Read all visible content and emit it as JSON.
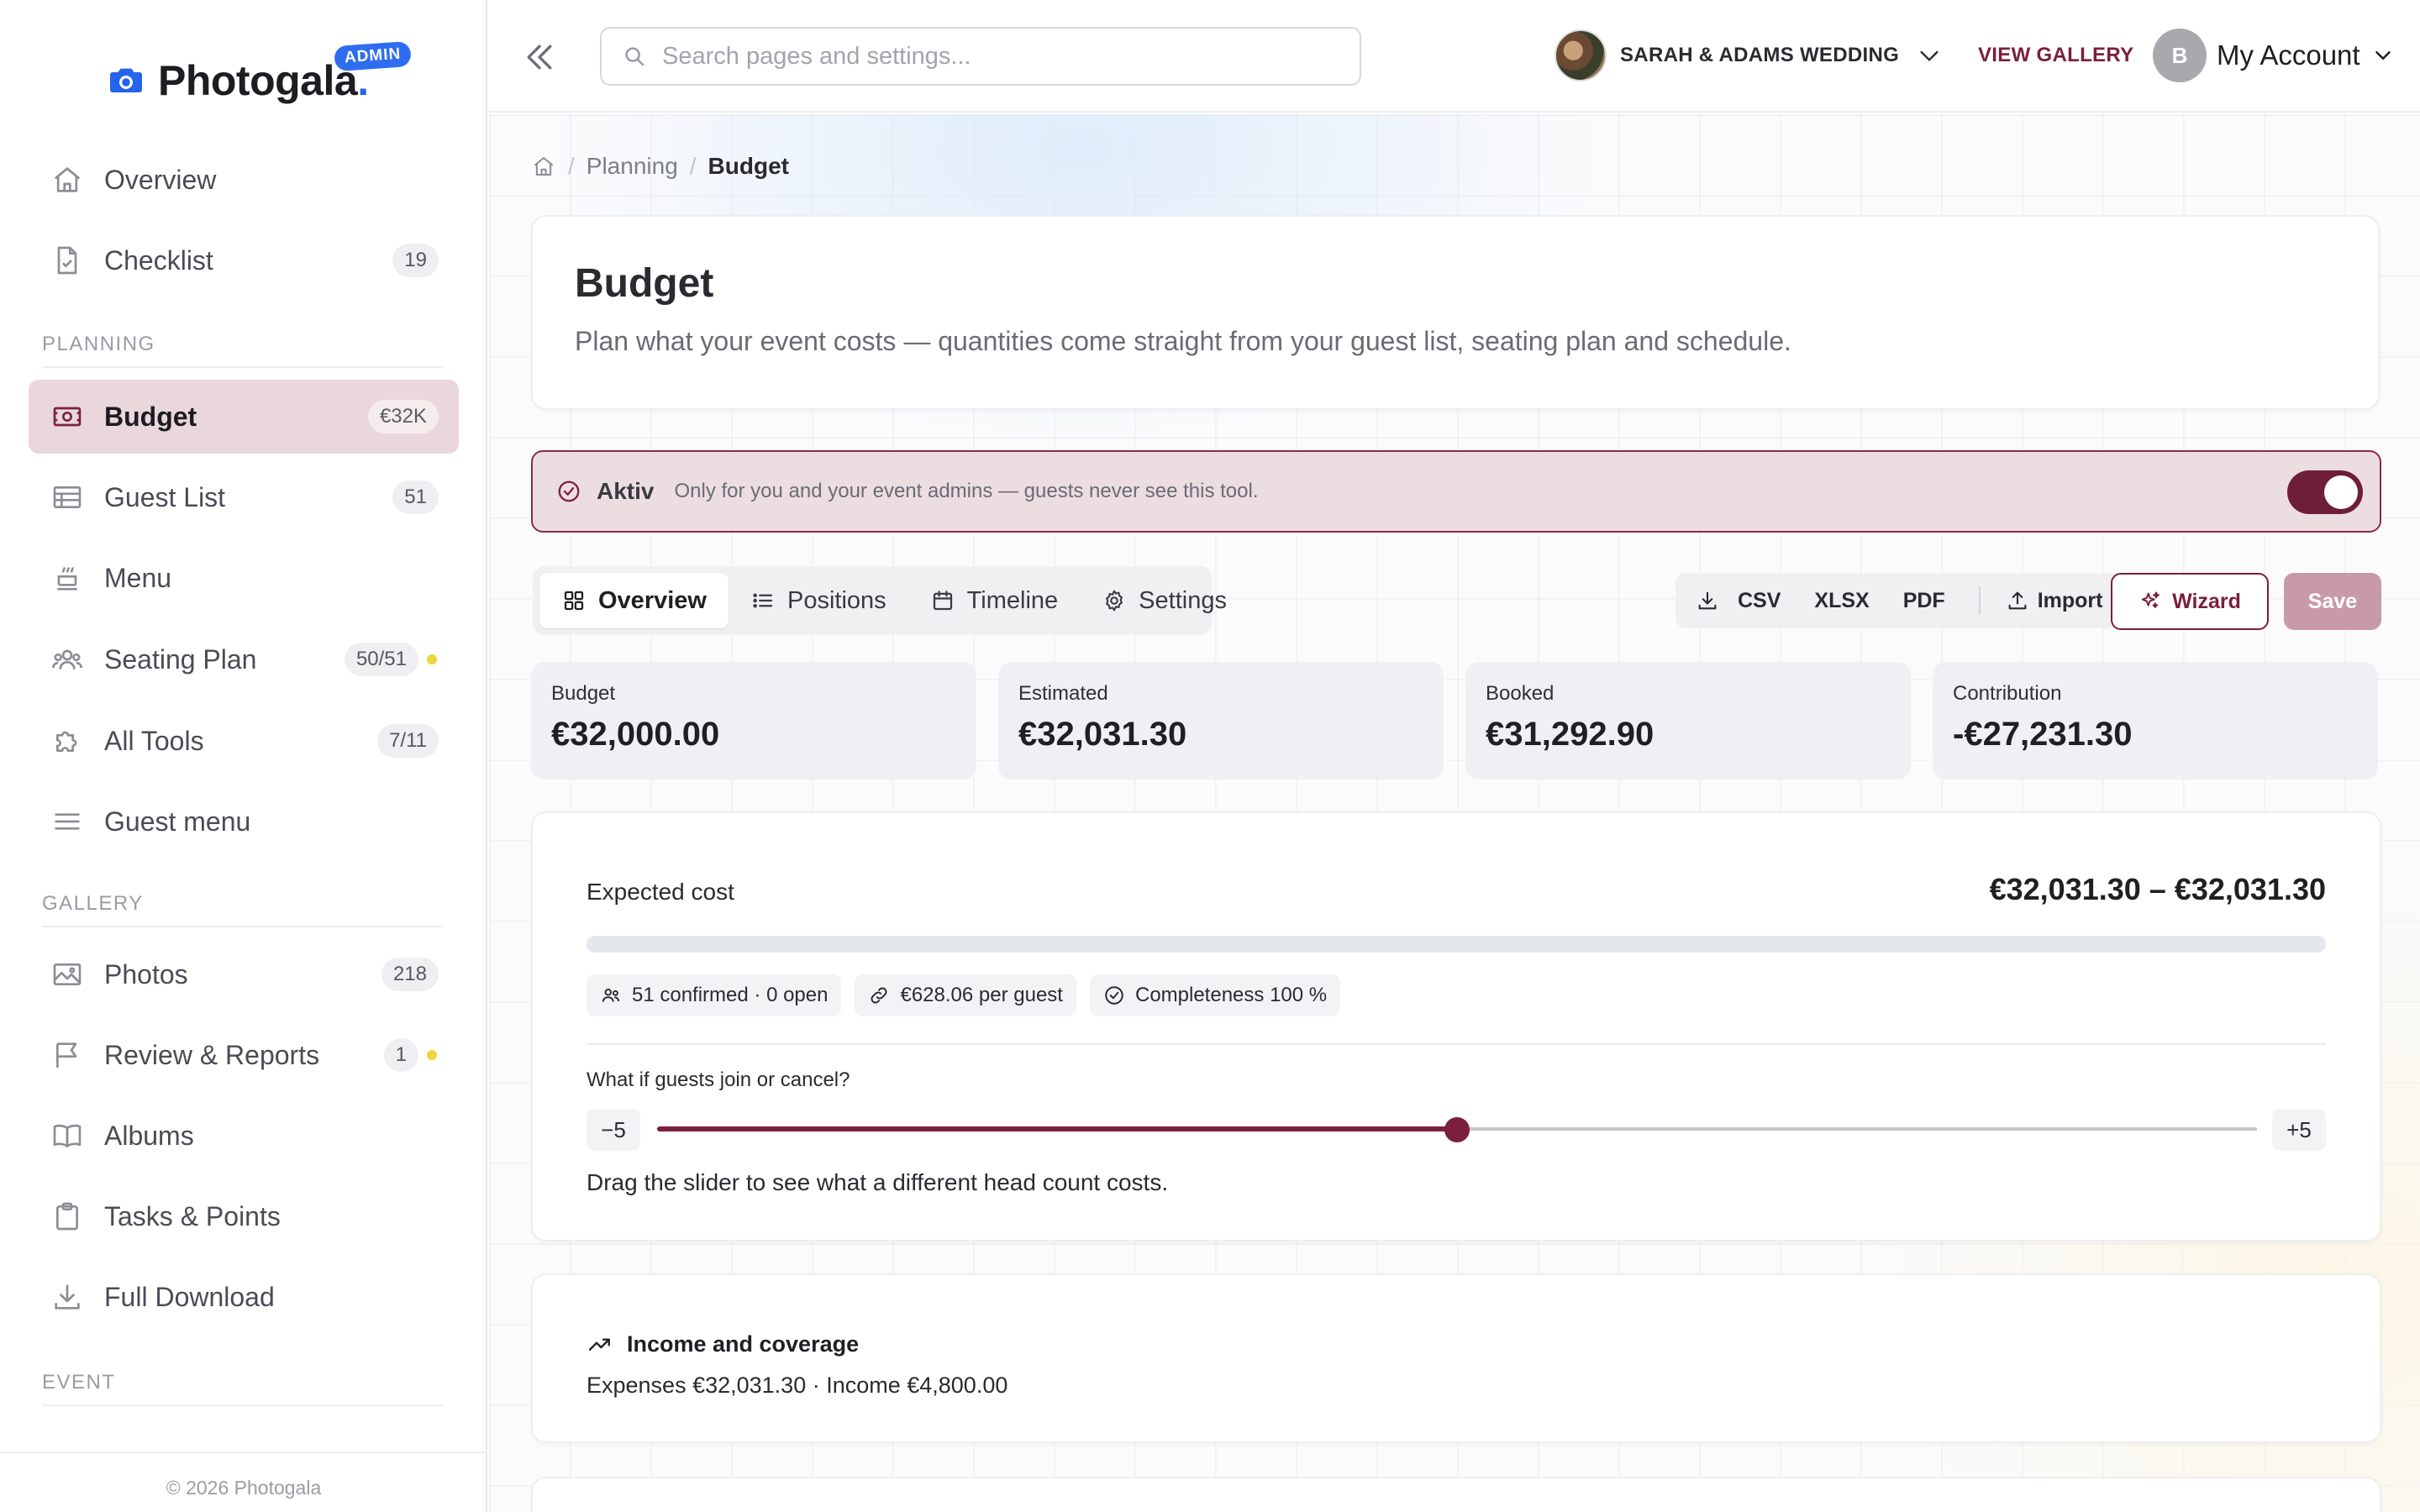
{
  "app": {
    "name": "Photogala",
    "name_dot": ".",
    "admin_badge": "ADMIN"
  },
  "sidebar": {
    "items": [
      {
        "label": "Overview",
        "icon": "home-icon"
      },
      {
        "label": "Checklist",
        "count": "19",
        "icon": "checklist-icon"
      }
    ],
    "sections": {
      "planning": "PLANNING",
      "gallery": "GALLERY",
      "event": "EVENT"
    },
    "planning_items": [
      {
        "label": "Budget",
        "count": "€32K",
        "icon": "money-icon",
        "active": true
      },
      {
        "label": "Guest List",
        "count": "51",
        "icon": "table-icon"
      },
      {
        "label": "Menu",
        "icon": "menu-tray-icon"
      },
      {
        "label": "Seating Plan",
        "count": "50/51",
        "icon": "people-icon",
        "dot": true
      },
      {
        "label": "All Tools",
        "count": "7/11",
        "icon": "puzzle-icon"
      },
      {
        "label": "Guest menu",
        "icon": "hamburger-icon"
      }
    ],
    "gallery_items": [
      {
        "label": "Photos",
        "count": "218",
        "icon": "image-icon"
      },
      {
        "label": "Review & Reports",
        "count": "1",
        "icon": "flag-icon",
        "dot": true
      },
      {
        "label": "Albums",
        "icon": "book-icon"
      },
      {
        "label": "Tasks & Points",
        "icon": "clipboard-icon"
      },
      {
        "label": "Full Download",
        "icon": "download-icon"
      }
    ],
    "copyright": "© 2026 Photogala"
  },
  "topbar": {
    "search_placeholder": "Search pages and settings...",
    "event_name": "SARAH & ADAMS WEDDING",
    "view_gallery": "VIEW GALLERY",
    "account_initial": "B",
    "account_label": "My Account"
  },
  "breadcrumb": {
    "sep": "/",
    "planning": "Planning",
    "current": "Budget"
  },
  "page": {
    "title": "Budget",
    "subtitle": "Plan what your event costs — quantities come straight from your guest list, seating plan and schedule."
  },
  "status_banner": {
    "title": "Aktiv",
    "description": "Only for you and your event admins — guests never see this tool.",
    "enabled": true
  },
  "tabs": [
    {
      "label": "Overview",
      "icon": "grid-icon",
      "active": true
    },
    {
      "label": "Positions",
      "icon": "list-icon"
    },
    {
      "label": "Timeline",
      "icon": "calendar-icon"
    },
    {
      "label": "Settings",
      "icon": "gear-icon"
    }
  ],
  "toolbar": {
    "csv": "CSV",
    "xlsx": "XLSX",
    "pdf": "PDF",
    "import": "Import",
    "wizard": "Wizard",
    "save": "Save"
  },
  "kpis": [
    {
      "label": "Budget",
      "value": "€32,000.00"
    },
    {
      "label": "Estimated",
      "value": "€32,031.30"
    },
    {
      "label": "Booked",
      "value": "€31,292.90"
    },
    {
      "label": "Contribution",
      "value": "-€27,231.30"
    }
  ],
  "expected_cost": {
    "title": "Expected cost",
    "range": "€32,031.30 – €32,031.30",
    "chips": [
      {
        "text": "51 confirmed · 0 open",
        "icon": "people-icon"
      },
      {
        "text": "€628.06 per guest",
        "icon": "link-icon"
      },
      {
        "text": "Completeness 100 %",
        "icon": "check-circle-icon"
      }
    ],
    "whatif_label": "What if guests join or cancel?",
    "slider": {
      "min_label": "−5",
      "max_label": "+5",
      "min": -5,
      "max": 5,
      "value": 0
    },
    "hint": "Drag the slider to see what a different head count costs."
  },
  "income": {
    "title": "Income and coverage",
    "line": "Expenses €32,031.30 · Income €4,800.00"
  },
  "colors": {
    "accent": "#7a1f3d",
    "active_bg": "#ead7dc",
    "brand_blue": "#2463eb",
    "badge_dot": "#f1d43a"
  }
}
